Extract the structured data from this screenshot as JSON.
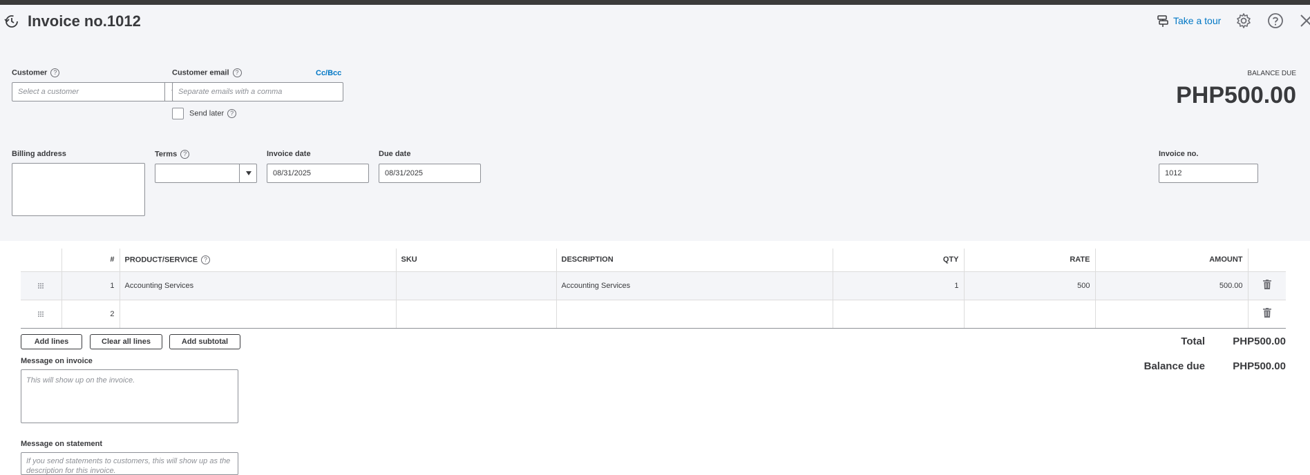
{
  "header": {
    "title": "Invoice no.1012",
    "tour_label": "Take a tour"
  },
  "customer": {
    "label": "Customer",
    "placeholder": "Select a customer"
  },
  "email": {
    "label": "Customer email",
    "placeholder": "Separate emails with a comma",
    "ccbcc": "Cc/Bcc",
    "send_later": "Send later"
  },
  "balance": {
    "label": "BALANCE DUE",
    "value": "PHP500.00"
  },
  "billing": {
    "label": "Billing address"
  },
  "terms": {
    "label": "Terms",
    "value": ""
  },
  "invoice_date": {
    "label": "Invoice date",
    "value": "08/31/2025"
  },
  "due_date": {
    "label": "Due date",
    "value": "08/31/2025"
  },
  "invoice_no": {
    "label": "Invoice no.",
    "value": "1012"
  },
  "table": {
    "columns": {
      "num": "#",
      "product": "PRODUCT/SERVICE",
      "sku": "SKU",
      "description": "DESCRIPTION",
      "qty": "QTY",
      "rate": "RATE",
      "amount": "AMOUNT"
    },
    "rows": [
      {
        "num": "1",
        "product": "Accounting Services",
        "sku": "",
        "description": "Accounting Services",
        "qty": "1",
        "rate": "500",
        "amount": "500.00"
      },
      {
        "num": "2",
        "product": "",
        "sku": "",
        "description": "",
        "qty": "",
        "rate": "",
        "amount": ""
      }
    ]
  },
  "buttons": {
    "add_lines": "Add lines",
    "clear_all": "Clear all lines",
    "add_subtotal": "Add subtotal"
  },
  "totals": {
    "total_label": "Total",
    "total_value": "PHP500.00",
    "balance_label": "Balance due",
    "balance_value": "PHP500.00"
  },
  "message_invoice": {
    "label": "Message on invoice",
    "placeholder": "This will show up on the invoice."
  },
  "message_statement": {
    "label": "Message on statement",
    "placeholder": "If you send statements to customers, this will show up as the description for this invoice."
  },
  "colors": {
    "accent": "#0077c5",
    "header_bg": "#f4f5f8",
    "topbar": "#3b3b3b"
  }
}
